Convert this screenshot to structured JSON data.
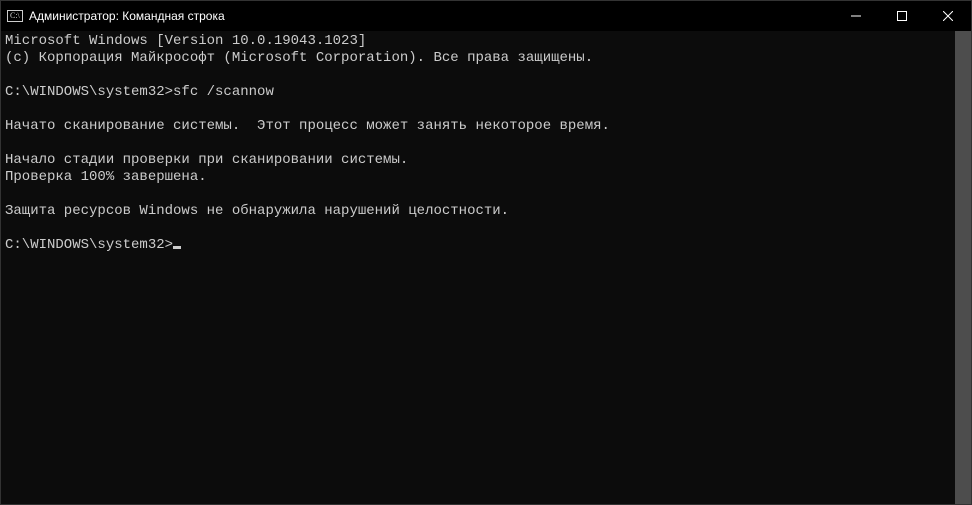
{
  "titlebar": {
    "title": "Администратор: Командная строка"
  },
  "terminal": {
    "lines": [
      "Microsoft Windows [Version 10.0.19043.1023]",
      "(c) Корпорация Майкрософт (Microsoft Corporation). Все права защищены.",
      "",
      "C:\\WINDOWS\\system32>sfc /scannow",
      "",
      "Начато сканирование системы.  Этот процесс может занять некоторое время.",
      "",
      "Начало стадии проверки при сканировании системы.",
      "Проверка 100% завершена.",
      "",
      "Защита ресурсов Windows не обнаружила нарушений целостности.",
      "",
      "C:\\WINDOWS\\system32>"
    ]
  }
}
